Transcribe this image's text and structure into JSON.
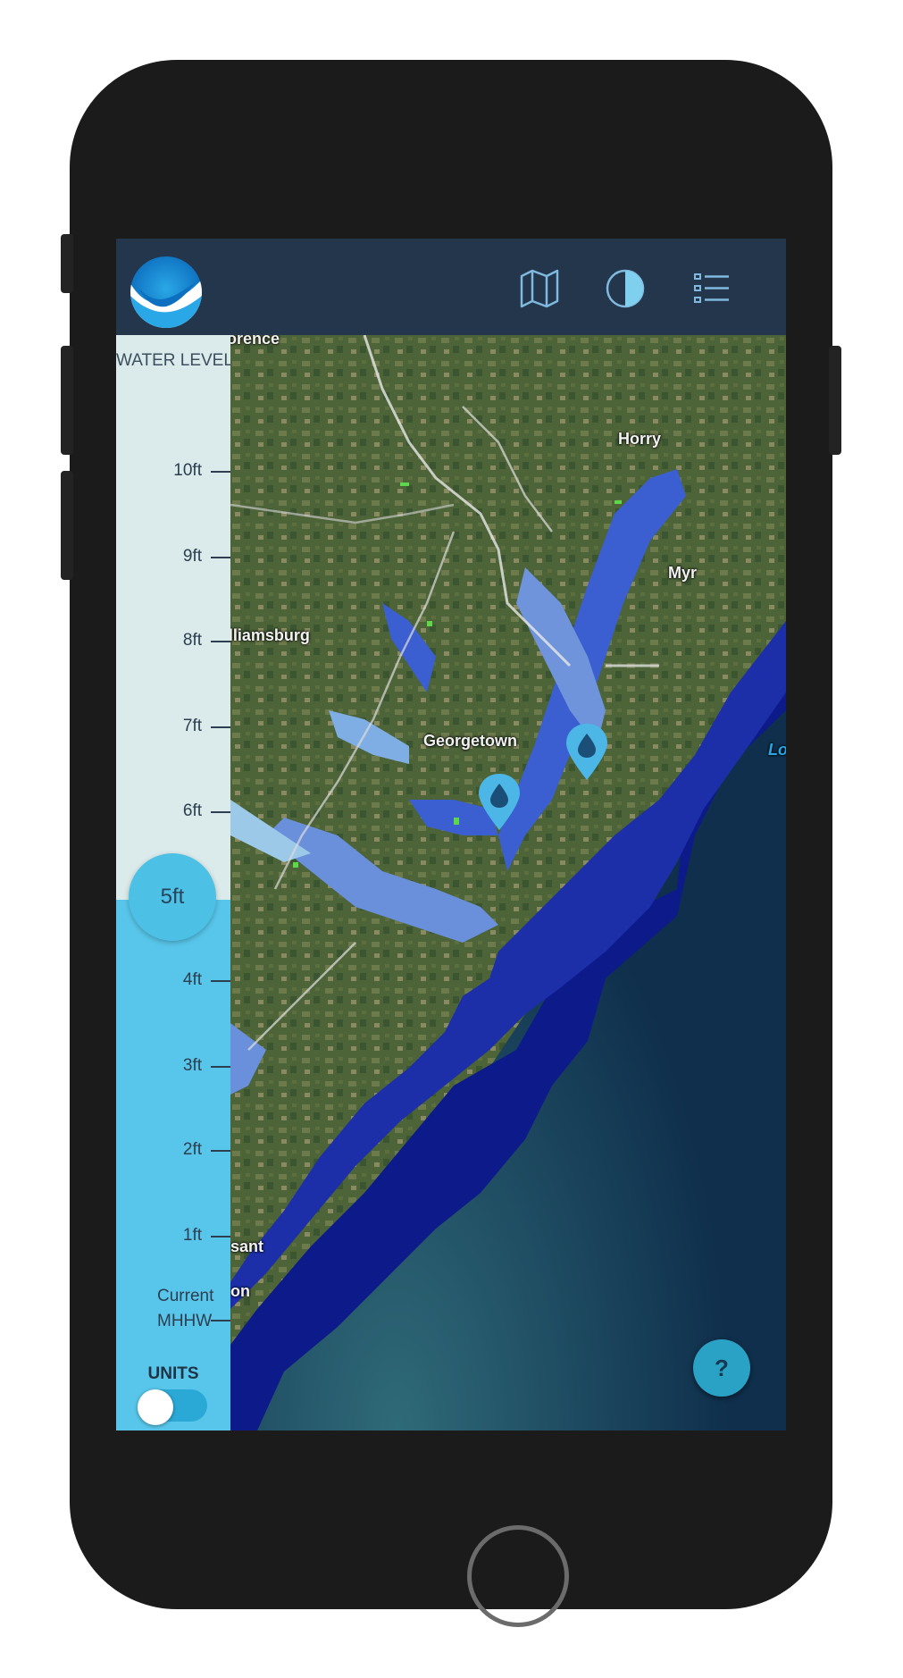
{
  "app": {
    "logo_icon": "noaa-bird-logo-icon",
    "toolbar_icons": [
      "map-icon",
      "contrast-icon",
      "list-icon"
    ]
  },
  "slider": {
    "title": "WATER LEVEL",
    "ticks": [
      "10ft",
      "9ft",
      "8ft",
      "7ft",
      "6ft",
      "4ft",
      "3ft",
      "2ft",
      "1ft"
    ],
    "selected_value": "5ft",
    "selected_level_ft": 5,
    "current_label_line1": "Current",
    "current_label_line2": "MHHW",
    "colors": {
      "empty": "#dbeaea",
      "filled": "#58c6ea",
      "knob": "#4dc0e6"
    }
  },
  "units": {
    "label": "UNITS",
    "toggle_state": "off"
  },
  "map": {
    "labels": {
      "florence": "Florence",
      "horry": "Horry",
      "myrtle": "Myr",
      "williamsburg": "Williamsburg",
      "georgetown": "Georgetown",
      "lo": "Lo",
      "pleasant": "sant",
      "charleston": "on"
    },
    "pins": [
      "water-gauge-pin",
      "water-gauge-pin"
    ],
    "colors": {
      "land": "#4a5e38",
      "ocean": "#10304d",
      "flood_deep": "#0d1a8a",
      "flood_mid": "#3b5fd0",
      "flood_light": "#8fc6e8"
    }
  },
  "help": {
    "label": "?"
  }
}
